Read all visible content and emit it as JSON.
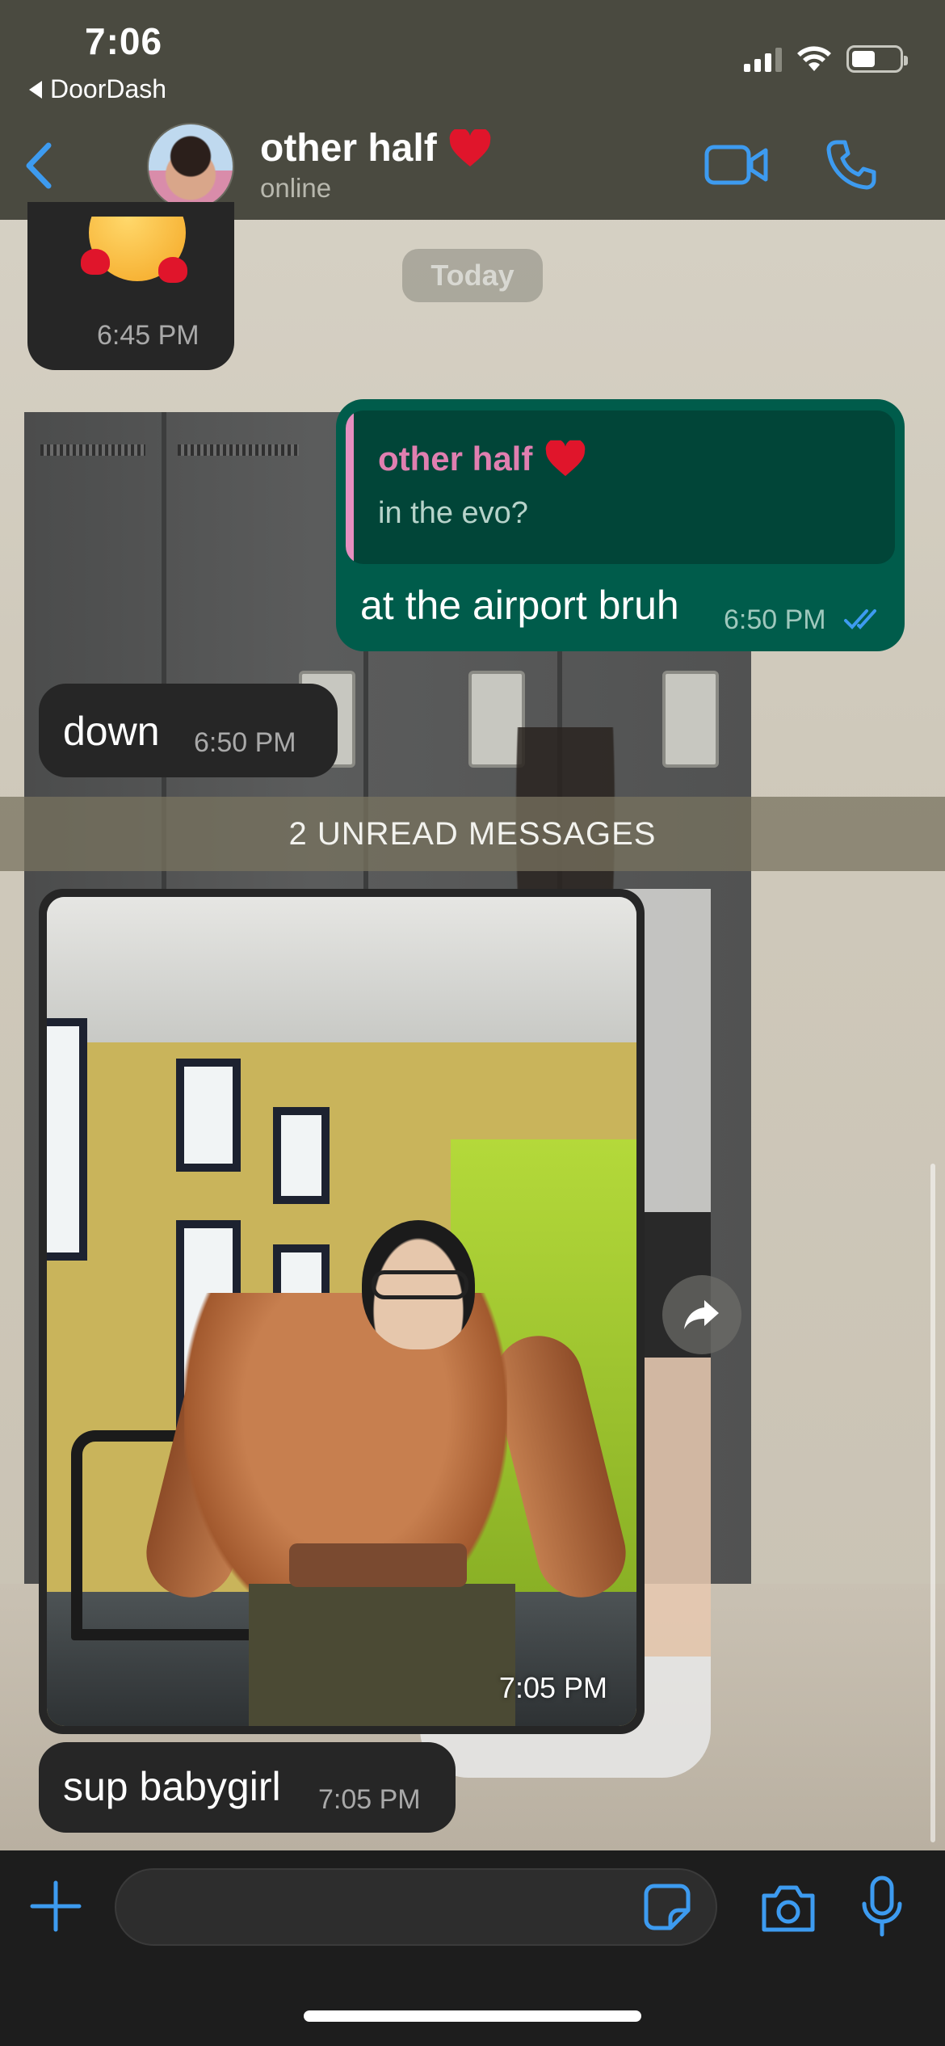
{
  "status_bar": {
    "time": "7:06",
    "back_app": "DoorDash",
    "battery_percent": 50,
    "signal_bars": 3
  },
  "header": {
    "contact_name": "other half",
    "contact_status": "online",
    "heart_emoji": "❤️"
  },
  "chat": {
    "date_chip": "Today",
    "messages": [
      {
        "direction": "incoming",
        "type": "emoji",
        "emoji": "🥰",
        "time": "6:45 PM"
      },
      {
        "direction": "outgoing",
        "quoted_name": "other half",
        "quoted_text": "in the evo?",
        "text": "at the airport bruh",
        "time": "6:50 PM",
        "read": true
      },
      {
        "direction": "incoming",
        "text": "down",
        "time": "6:50 PM"
      },
      {
        "direction": "incoming",
        "type": "photo",
        "time": "7:05 PM"
      },
      {
        "direction": "incoming",
        "text": "sup babygirl",
        "time": "7:05 PM"
      }
    ],
    "unread_banner": "2 UNREAD MESSAGES"
  },
  "composer": {
    "input_value": "",
    "placeholder": ""
  },
  "colors": {
    "accent_blue": "#3d9bf0",
    "outgoing_bubble": "#005c4b",
    "incoming_bubble": "#262626",
    "quote_bar": "#e58fc0"
  },
  "icons": [
    "back-chevron-icon",
    "video-call-icon",
    "phone-icon",
    "forward-icon",
    "plus-icon",
    "sticker-icon",
    "camera-icon",
    "microphone-icon",
    "double-check-icon"
  ]
}
